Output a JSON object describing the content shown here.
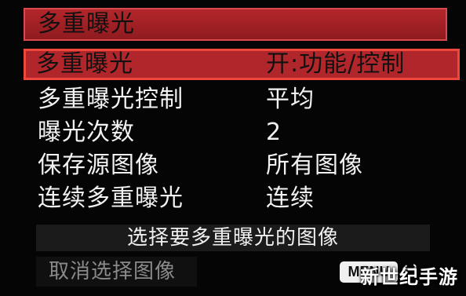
{
  "title": "多重曝光",
  "menu": [
    {
      "label": "多重曝光",
      "value": "开:功能/控制",
      "selected": true
    },
    {
      "label": "多重曝光控制",
      "value": "平均",
      "selected": false
    },
    {
      "label": "曝光次数",
      "value": "2",
      "selected": false
    },
    {
      "label": "保存源图像",
      "value": "所有图像",
      "selected": false
    },
    {
      "label": "连续多重曝光",
      "value": "连续",
      "selected": false
    }
  ],
  "actions": {
    "select_images": "选择要多重曝光的图像",
    "cancel_selection": "取消选择图像",
    "menu_button": "MENU",
    "return_icon": "↩"
  },
  "watermark": "新世纪手游",
  "colors": {
    "accent_red": "#b1262a",
    "highlight_border": "#f0473d",
    "text": "#f2f2f2",
    "disabled_text": "#8a8a8a",
    "background": "#050505"
  }
}
